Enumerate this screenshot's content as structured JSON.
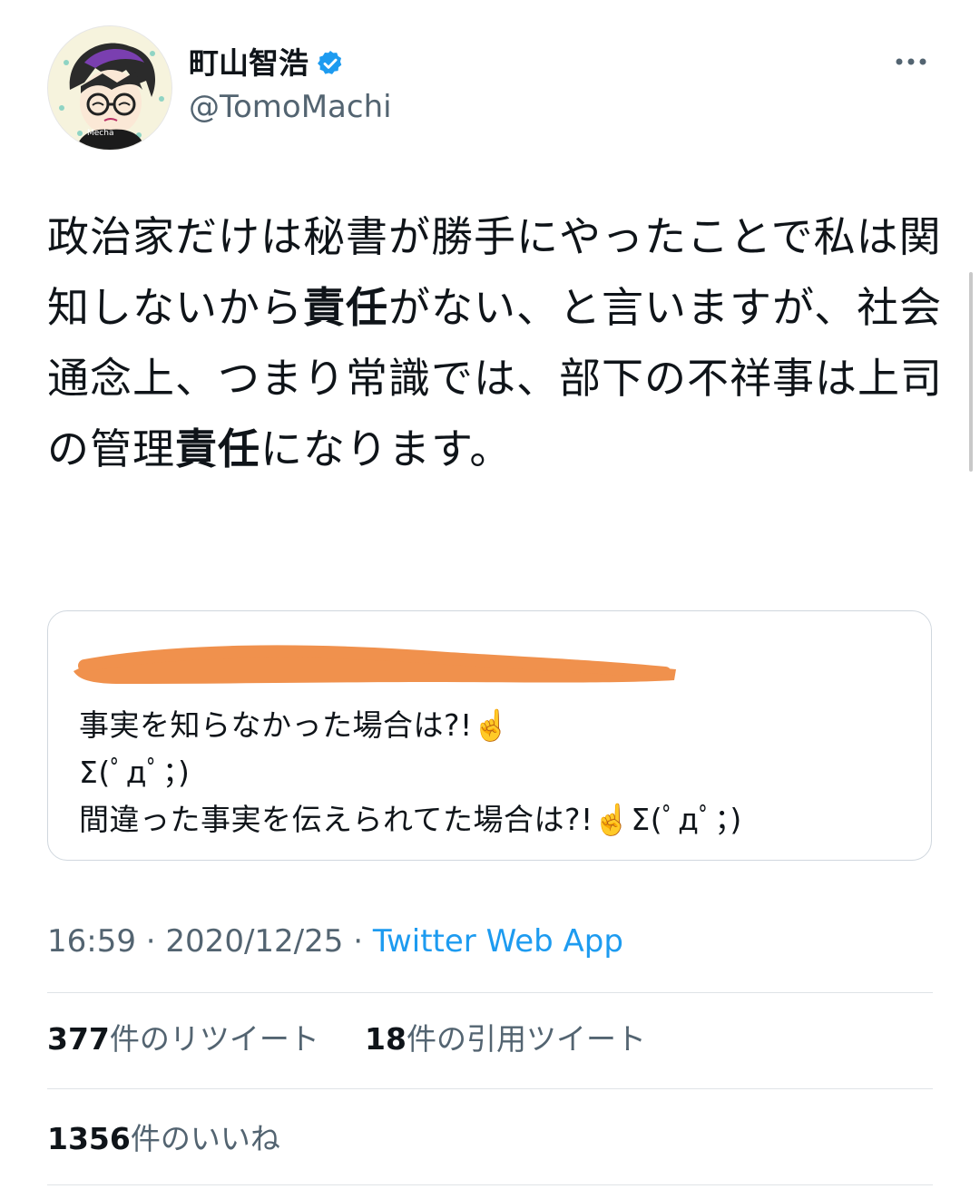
{
  "author": {
    "display_name": "町山智浩",
    "handle": "@TomoMachi",
    "avatar_caption": "Mecha",
    "verified_icon": "verified-badge-icon",
    "colors": {
      "verified": "#1d9bf0"
    }
  },
  "more_icon": "more-horizontal-icon",
  "tweet": {
    "segments": [
      {
        "text": "政治家だけは秘書が勝手にやったことで私は関知しないから",
        "bold": false
      },
      {
        "text": "責任",
        "bold": true
      },
      {
        "text": "がない、と言いますが、社会通念上、つまり常識では、部下の不祥事は上司の管理",
        "bold": false
      },
      {
        "text": "責任",
        "bold": true
      },
      {
        "text": "になります。",
        "bold": false
      }
    ]
  },
  "quote": {
    "author_redacted": true,
    "lines": [
      "事実を知らなかった場合は?!☝️",
      "Σ(ﾟдﾟ；)",
      "間違った事実を伝えられてた場合は?!☝️Σ(ﾟдﾟ；)"
    ],
    "colors": {
      "redaction": "#f0914d"
    }
  },
  "meta": {
    "time": "16:59",
    "date": "2020/12/25",
    "separator": "·",
    "source": "Twitter Web App"
  },
  "stats": {
    "retweets": {
      "count": "377",
      "label": "件のリツイート"
    },
    "quotes": {
      "count": "18",
      "label": "件の引用ツイート"
    },
    "likes": {
      "count": "1356",
      "label": "件のいいね"
    }
  }
}
